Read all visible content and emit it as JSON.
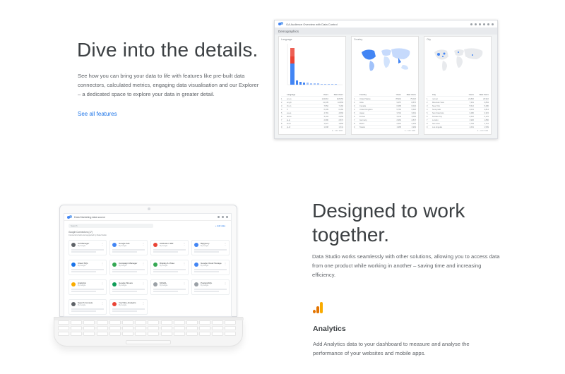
{
  "details": {
    "title": "Dive into the details.",
    "description": "See how you can bring your data to life with features like pre-built data connectors, calculated metrics, engaging data visualisation and our Explorer – a dedicated space to explore your data in greater detail.",
    "link": "See all features"
  },
  "dashboard": {
    "title": "GA Audience Overview with Data Control",
    "section": "Demographics",
    "panels": [
      {
        "label": "Language",
        "col1": "Users",
        "col2": "New Users",
        "rows": [
          [
            "1",
            "en-us",
            "124,810",
            "118,053"
          ],
          [
            "2",
            "en-gb",
            "11,235",
            "10,869"
          ],
          [
            "3",
            "zh-cn",
            "7,552",
            "7,182"
          ],
          [
            "4",
            "fr",
            "6,409",
            "6,184"
          ],
          [
            "5",
            "es-es",
            "4,781",
            "4,566"
          ],
          [
            "6",
            "de-de",
            "3,104",
            "2,959"
          ],
          [
            "7",
            "ja-jp",
            "2,980",
            "2,872"
          ],
          [
            "8",
            "ko-kr",
            "1,927",
            "1,850"
          ],
          [
            "9",
            "pt-br",
            "1,608",
            "1,541"
          ],
          [
            "10",
            "ru",
            "1,122",
            "1,069"
          ]
        ],
        "pager": "1 - 10 / 100"
      },
      {
        "label": "Country",
        "col1": "Users",
        "col2": "New Users",
        "rows": [
          [
            "1",
            "United States",
            "78,919",
            "75,026"
          ],
          [
            "2",
            "India",
            "9,357",
            "8,876"
          ],
          [
            "3",
            "Canada",
            "6,386",
            "6,016"
          ],
          [
            "4",
            "United Kingdom",
            "5,781",
            "5,520"
          ],
          [
            "5",
            "Japan",
            "3,719",
            "3,601"
          ],
          [
            "6",
            "France",
            "3,142",
            "3,006"
          ],
          [
            "7",
            "Germany",
            "2,981",
            "2,847"
          ],
          [
            "8",
            "Brazil",
            "2,316",
            "2,219"
          ],
          [
            "9",
            "Taiwan",
            "1,985",
            "1,909"
          ],
          [
            "10",
            "Australia",
            "1,866",
            "1,782"
          ]
        ],
        "pager": "1 - 10 / 100"
      },
      {
        "label": "City",
        "col1": "Users",
        "col2": "New Users",
        "rows": [
          [
            "1",
            "not set",
            "21,802",
            "20,910"
          ],
          [
            "2",
            "Mountain View",
            "7,301",
            "6,854"
          ],
          [
            "3",
            "New York",
            "5,512",
            "5,280"
          ],
          [
            "4",
            "Sunnyvale",
            "4,021",
            "3,814"
          ],
          [
            "5",
            "San Francisco",
            "3,480",
            "3,315"
          ],
          [
            "6",
            "Kansas City",
            "2,210",
            "2,121"
          ],
          [
            "7",
            "London",
            "1,906",
            "1,850"
          ],
          [
            "8",
            "San Jose",
            "1,794",
            "1,712"
          ],
          [
            "9",
            "Los Angeles",
            "1,601",
            "1,539"
          ],
          [
            "10",
            "Seattle",
            "1,372",
            "1,310"
          ]
        ],
        "pager": "1 - 10 / 100"
      }
    ]
  },
  "laptop_screen": {
    "title": "Data Marketing data source",
    "search_placeholder": "Search",
    "link": "+ Add data",
    "header": "Google Connectors (17)",
    "subheader": "Connectors built and supported by Data Studio",
    "connectors": [
      {
        "name": "Ad Manager",
        "by": "By Google",
        "color": "#5f6368"
      },
      {
        "name": "Google Ads",
        "by": "By Google",
        "color": "#4285f4"
      },
      {
        "name": "Attribution 360",
        "by": "By Google",
        "color": "#ea4335"
      },
      {
        "name": "BigQuery",
        "by": "By Google",
        "color": "#4285f4"
      },
      {
        "name": "Cloud SQL",
        "by": "By Google",
        "color": "#1a73e8"
      },
      {
        "name": "Campaign Manager",
        "by": "By Google",
        "color": "#34a853"
      },
      {
        "name": "Display & Video",
        "by": "By Google",
        "color": "#34a853"
      },
      {
        "name": "Google Cloud Storage",
        "by": "By Google",
        "color": "#4285f4"
      },
      {
        "name": "Analytics",
        "by": "By Google",
        "color": "#f9ab00"
      },
      {
        "name": "Google Sheets",
        "by": "By Google",
        "color": "#0f9d58"
      },
      {
        "name": "MySQL",
        "by": "By Google",
        "color": "#9aa0a6"
      },
      {
        "name": "PostgreSQL",
        "by": "By Google",
        "color": "#9aa0a6"
      },
      {
        "name": "Search Console",
        "by": "By Google",
        "color": "#5f6368"
      },
      {
        "name": "YouTube Analytics",
        "by": "By Google",
        "color": "#ea4335"
      }
    ]
  },
  "together": {
    "title": "Designed to work together.",
    "description": "Data Studio works seamlessly with other solutions, allowing you to access data from one product while working in another – saving time and increasing efficiency.",
    "subheading": "Analytics",
    "sub_description": "Add Analytics data to your dashboard to measure and analyse the performance of your websites and mobile apps.",
    "icon": "analytics-icon"
  }
}
